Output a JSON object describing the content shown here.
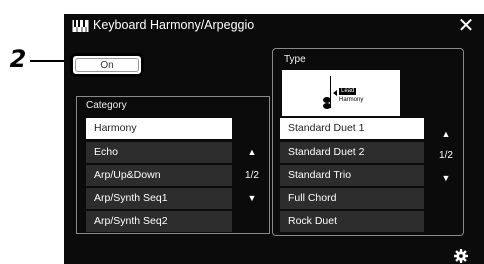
{
  "callout": {
    "number": "2"
  },
  "titlebar": {
    "title": "Keyboard Harmony/Arpeggio",
    "close_glyph": "✕"
  },
  "on_button": {
    "label": "On"
  },
  "category": {
    "label": "Category",
    "items": [
      "Harmony",
      "Echo",
      "Arp/Up&Down",
      "Arp/Synth Seq1",
      "Arp/Synth Seq2"
    ],
    "selected_index": 0,
    "page": "1/2",
    "up_glyph": "▲",
    "down_glyph": "▼"
  },
  "type": {
    "label": "Type",
    "image_badge": "Lead",
    "image_caption": "Harmony",
    "items": [
      "Standard Duet 1",
      "Standard Duet 2",
      "Standard Trio",
      "Full Chord",
      "Rock Duet"
    ],
    "selected_index": 0,
    "page": "1/2",
    "up_glyph": "▲",
    "down_glyph": "▼"
  },
  "icons": {
    "app": "keyboard-icon",
    "close": "close-icon",
    "settings": "gear-icon"
  }
}
